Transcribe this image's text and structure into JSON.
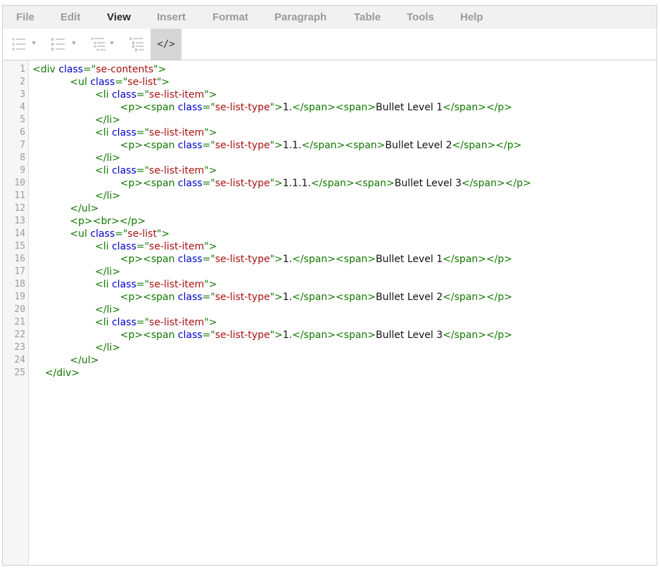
{
  "menu": [
    "File",
    "Edit",
    "View",
    "Insert",
    "Format",
    "Paragraph",
    "Table",
    "Tools",
    "Help"
  ],
  "active_menu": "View",
  "toolbar": {
    "buttons": [
      {
        "name": "bullet-list-icon",
        "has_dropdown": true
      },
      {
        "name": "numbered-list-icon",
        "has_dropdown": true
      },
      {
        "name": "multilevel-list-icon",
        "has_dropdown": true
      },
      {
        "name": "numbered-multilevel-list-icon",
        "has_dropdown": false
      },
      {
        "name": "code-view-icon",
        "label": "</>",
        "active": true
      }
    ]
  },
  "source": {
    "line_numbers": [
      "1",
      "2",
      "3",
      "4",
      "5",
      "6",
      "7",
      "8",
      "9",
      "10",
      "11",
      "12",
      "13",
      "14",
      "15",
      "16",
      "17",
      "18",
      "19",
      "20",
      "21",
      "22",
      "23",
      "24",
      "25"
    ],
    "lines": [
      [
        [
          "<div ",
          "tag"
        ],
        [
          "class",
          "attr"
        ],
        [
          "=\"",
          "tag"
        ],
        [
          "se-contents",
          "val"
        ],
        [
          "\">",
          "tag"
        ]
      ],
      [
        [
          "            ",
          "text"
        ],
        [
          "<ul ",
          "tag"
        ],
        [
          "class",
          "attr"
        ],
        [
          "=\"",
          "tag"
        ],
        [
          "se-list",
          "val"
        ],
        [
          "\">",
          "tag"
        ]
      ],
      [
        [
          "                    ",
          "text"
        ],
        [
          "<li ",
          "tag"
        ],
        [
          "class",
          "attr"
        ],
        [
          "=\"",
          "tag"
        ],
        [
          "se-list-item",
          "val"
        ],
        [
          "\">",
          "tag"
        ]
      ],
      [
        [
          "                            ",
          "text"
        ],
        [
          "<p><span ",
          "tag"
        ],
        [
          "class",
          "attr"
        ],
        [
          "=\"",
          "tag"
        ],
        [
          "se-list-type",
          "val"
        ],
        [
          "\">",
          "tag"
        ],
        [
          "1.",
          "text"
        ],
        [
          "</span><span>",
          "tag"
        ],
        [
          "Bullet Level 1",
          "text"
        ],
        [
          "</span></p>",
          "tag"
        ]
      ],
      [
        [
          "                    ",
          "text"
        ],
        [
          "</li>",
          "tag"
        ]
      ],
      [
        [
          "                    ",
          "text"
        ],
        [
          "<li ",
          "tag"
        ],
        [
          "class",
          "attr"
        ],
        [
          "=\"",
          "tag"
        ],
        [
          "se-list-item",
          "val"
        ],
        [
          "\">",
          "tag"
        ]
      ],
      [
        [
          "                            ",
          "text"
        ],
        [
          "<p><span ",
          "tag"
        ],
        [
          "class",
          "attr"
        ],
        [
          "=\"",
          "tag"
        ],
        [
          "se-list-type",
          "val"
        ],
        [
          "\">",
          "tag"
        ],
        [
          "1.1.",
          "text"
        ],
        [
          "</span><span>",
          "tag"
        ],
        [
          "Bullet Level 2",
          "text"
        ],
        [
          "</span></p>",
          "tag"
        ]
      ],
      [
        [
          "                    ",
          "text"
        ],
        [
          "</li>",
          "tag"
        ]
      ],
      [
        [
          "                    ",
          "text"
        ],
        [
          "<li ",
          "tag"
        ],
        [
          "class",
          "attr"
        ],
        [
          "=\"",
          "tag"
        ],
        [
          "se-list-item",
          "val"
        ],
        [
          "\">",
          "tag"
        ]
      ],
      [
        [
          "                            ",
          "text"
        ],
        [
          "<p><span ",
          "tag"
        ],
        [
          "class",
          "attr"
        ],
        [
          "=\"",
          "tag"
        ],
        [
          "se-list-type",
          "val"
        ],
        [
          "\">",
          "tag"
        ],
        [
          "1.1.1.",
          "text"
        ],
        [
          "</span><span>",
          "tag"
        ],
        [
          "Bullet Level 3",
          "text"
        ],
        [
          "</span></p>",
          "tag"
        ]
      ],
      [
        [
          "                    ",
          "text"
        ],
        [
          "</li>",
          "tag"
        ]
      ],
      [
        [
          "            ",
          "text"
        ],
        [
          "</ul>",
          "tag"
        ]
      ],
      [
        [
          "            ",
          "text"
        ],
        [
          "<p><br></p>",
          "tag"
        ]
      ],
      [
        [
          "            ",
          "text"
        ],
        [
          "<ul ",
          "tag"
        ],
        [
          "class",
          "attr"
        ],
        [
          "=\"",
          "tag"
        ],
        [
          "se-list",
          "val"
        ],
        [
          "\">",
          "tag"
        ]
      ],
      [
        [
          "                    ",
          "text"
        ],
        [
          "<li ",
          "tag"
        ],
        [
          "class",
          "attr"
        ],
        [
          "=\"",
          "tag"
        ],
        [
          "se-list-item",
          "val"
        ],
        [
          "\">",
          "tag"
        ]
      ],
      [
        [
          "                            ",
          "text"
        ],
        [
          "<p><span ",
          "tag"
        ],
        [
          "class",
          "attr"
        ],
        [
          "=\"",
          "tag"
        ],
        [
          "se-list-type",
          "val"
        ],
        [
          "\">",
          "tag"
        ],
        [
          "1.",
          "text"
        ],
        [
          "</span><span>",
          "tag"
        ],
        [
          "Bullet Level 1",
          "text"
        ],
        [
          "</span></p>",
          "tag"
        ]
      ],
      [
        [
          "                    ",
          "text"
        ],
        [
          "</li>",
          "tag"
        ]
      ],
      [
        [
          "                    ",
          "text"
        ],
        [
          "<li ",
          "tag"
        ],
        [
          "class",
          "attr"
        ],
        [
          "=\"",
          "tag"
        ],
        [
          "se-list-item",
          "val"
        ],
        [
          "\">",
          "tag"
        ]
      ],
      [
        [
          "                            ",
          "text"
        ],
        [
          "<p><span ",
          "tag"
        ],
        [
          "class",
          "attr"
        ],
        [
          "=\"",
          "tag"
        ],
        [
          "se-list-type",
          "val"
        ],
        [
          "\">",
          "tag"
        ],
        [
          "1.",
          "text"
        ],
        [
          "</span><span>",
          "tag"
        ],
        [
          "Bullet Level 2",
          "text"
        ],
        [
          "</span></p>",
          "tag"
        ]
      ],
      [
        [
          "                    ",
          "text"
        ],
        [
          "</li>",
          "tag"
        ]
      ],
      [
        [
          "                    ",
          "text"
        ],
        [
          "<li ",
          "tag"
        ],
        [
          "class",
          "attr"
        ],
        [
          "=\"",
          "tag"
        ],
        [
          "se-list-item",
          "val"
        ],
        [
          "\">",
          "tag"
        ]
      ],
      [
        [
          "                            ",
          "text"
        ],
        [
          "<p><span ",
          "tag"
        ],
        [
          "class",
          "attr"
        ],
        [
          "=\"",
          "tag"
        ],
        [
          "se-list-type",
          "val"
        ],
        [
          "\">",
          "tag"
        ],
        [
          "1.",
          "text"
        ],
        [
          "</span><span>",
          "tag"
        ],
        [
          "Bullet Level 3",
          "text"
        ],
        [
          "</span></p>",
          "tag"
        ]
      ],
      [
        [
          "                    ",
          "text"
        ],
        [
          "</li>",
          "tag"
        ]
      ],
      [
        [
          "            ",
          "text"
        ],
        [
          "</ul>",
          "tag"
        ]
      ],
      [
        [
          "    ",
          "text"
        ],
        [
          "</div>",
          "tag"
        ]
      ]
    ]
  },
  "colors": {
    "tag": "#117700",
    "attr": "#0000cc",
    "value": "#aa1111",
    "gutter_bg": "#f6f6f6",
    "menubar_bg": "#f1f1f1",
    "active_tool_bg": "#d6d6d6"
  }
}
